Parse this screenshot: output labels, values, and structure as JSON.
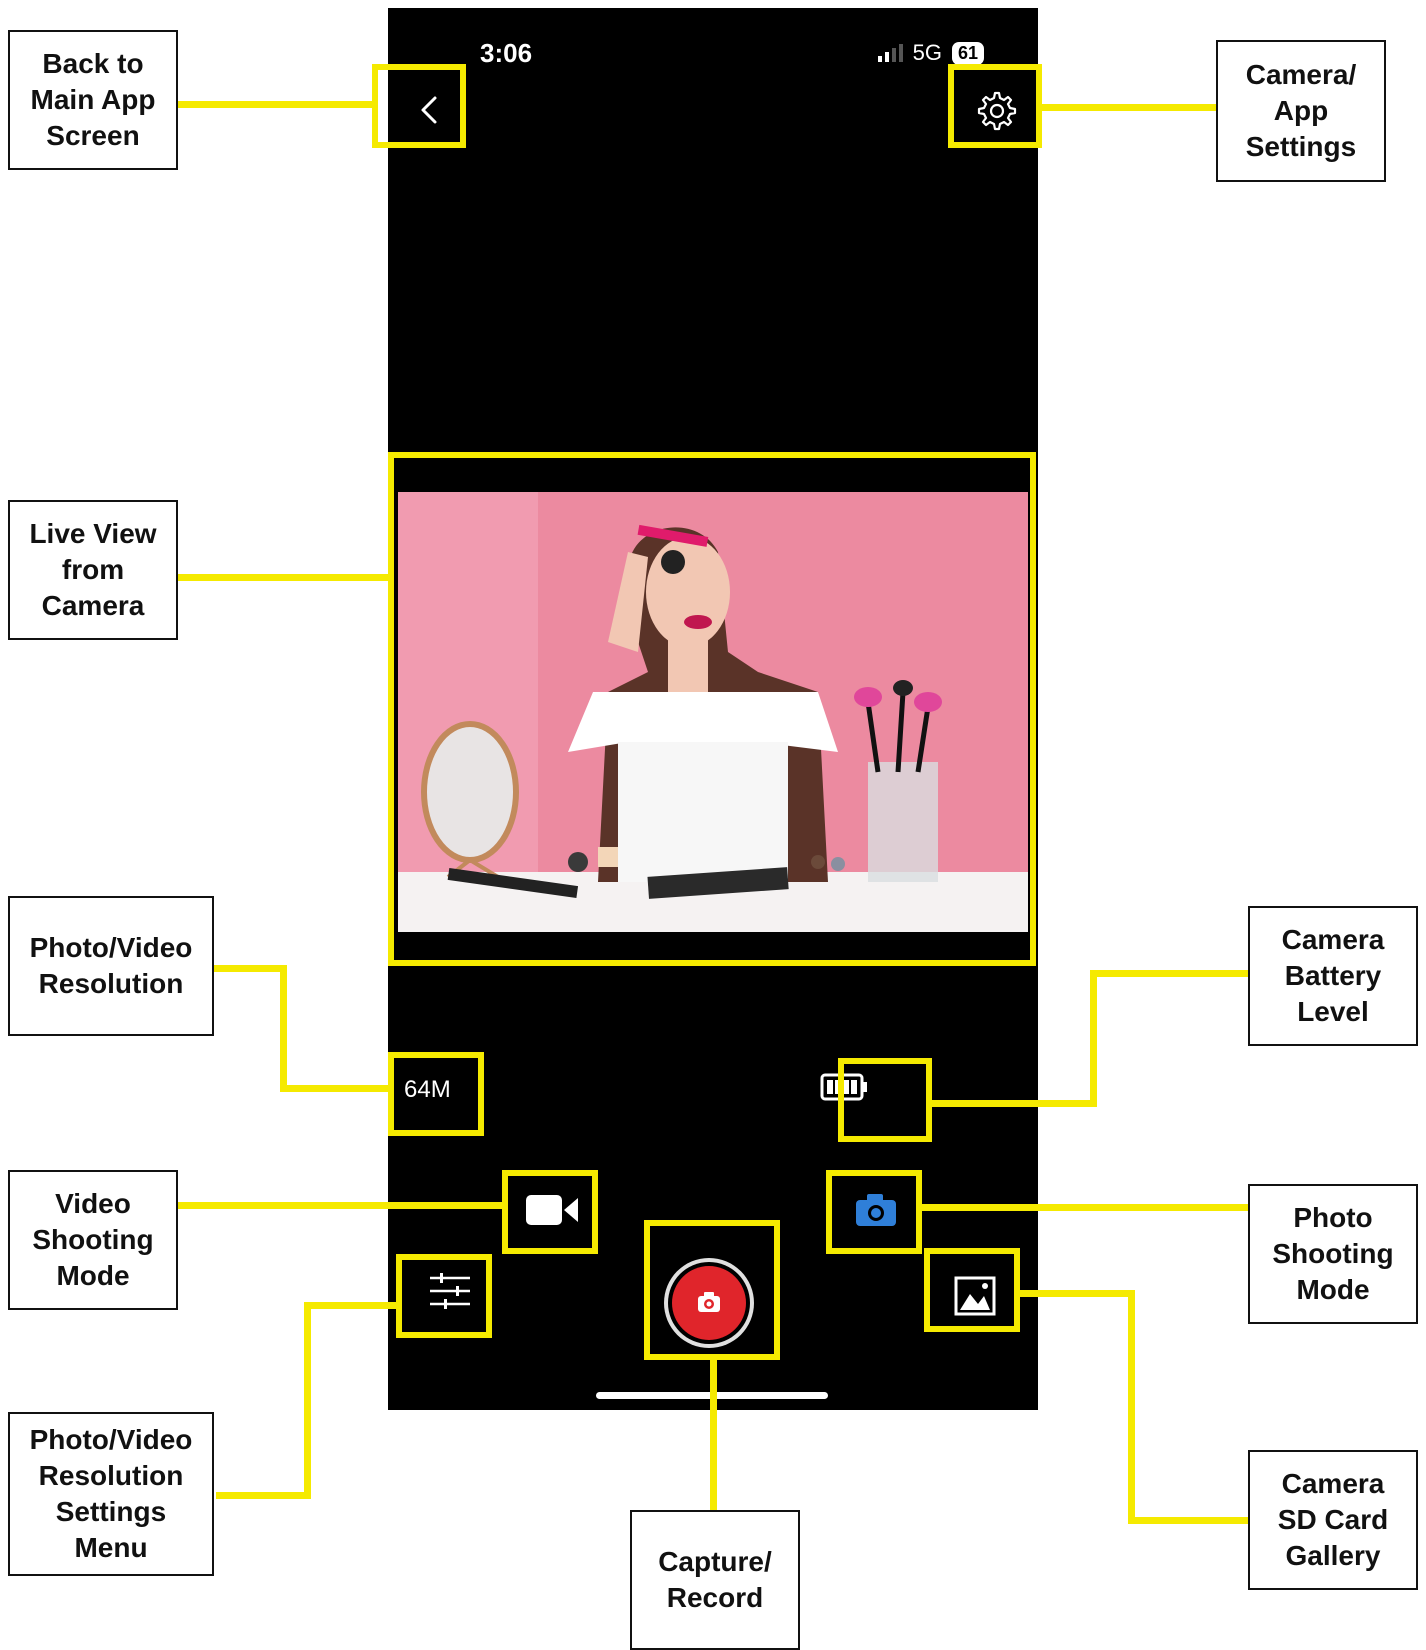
{
  "status_bar": {
    "time": "3:06",
    "network": "5G",
    "battery": "61"
  },
  "camera": {
    "resolution": "64M"
  },
  "callouts": {
    "back": "Back to\nMain App\nScreen",
    "settings": "Camera/\nApp\nSettings",
    "live_view": "Live View\nfrom\nCamera",
    "resolution": "Photo/Video\nResolution",
    "battery": "Camera\nBattery\nLevel",
    "video_mode": "Video\nShooting\nMode",
    "photo_mode": "Photo\nShooting\nMode",
    "res_menu": "Photo/Video\nResolution\nSettings\nMenu",
    "gallery": "Camera\nSD Card\nGallery",
    "capture": "Capture/\nRecord"
  },
  "icons": {
    "back": "chevron-left-icon",
    "settings": "gear-icon",
    "battery": "battery-icon",
    "video": "video-camera-icon",
    "photo": "camera-icon",
    "menu": "sliders-icon",
    "gallery": "gallery-icon",
    "capture": "shutter-button"
  },
  "colors": {
    "highlight": "#f5ea00",
    "shutter": "#e0252b",
    "photo_mode_active": "#2f7fd8"
  }
}
